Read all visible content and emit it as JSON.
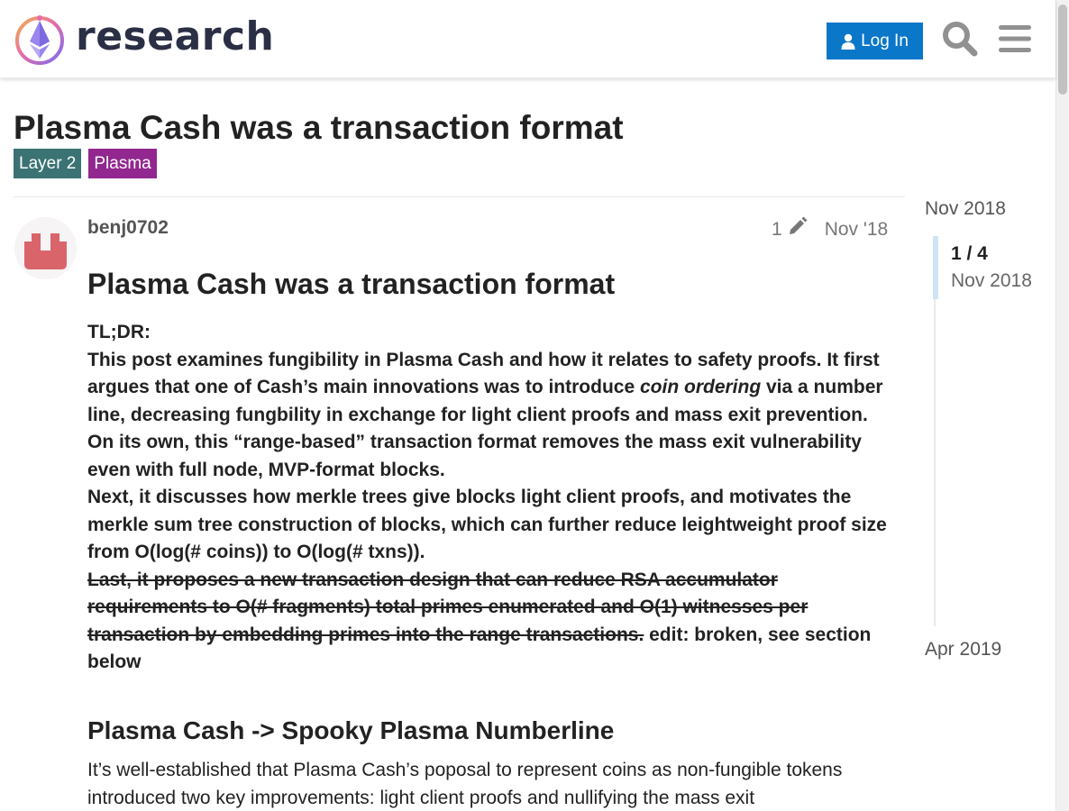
{
  "header": {
    "logo_text": "research",
    "login_label": "Log In",
    "icons": [
      "user-icon",
      "search-icon",
      "hamburger-menu-icon"
    ]
  },
  "topic": {
    "title": "Plasma Cash was a transaction format",
    "tags": [
      "Layer 2",
      "Plasma"
    ],
    "tag_colors": [
      "#3b7273",
      "#92278f"
    ]
  },
  "post": {
    "username": "benj0702",
    "edit_count": "1",
    "date": "Nov '18",
    "heading": "Plasma Cash was a transaction format",
    "tldr_label": "TL;DR:",
    "tldr_p1_a": "This post examines fungibility in Plasma Cash and how it relates to safety proofs. It first argues that one of Cash’s main innovations was to introduce ",
    "tldr_p1_em": "coin ordering",
    "tldr_p1_b": " via a number line, decreasing fungbility in exchange for light client proofs and mass exit prevention. On its own, this “range-based” transaction format removes the mass exit vulnerability even with full node, MVP-format blocks.",
    "tldr_p2": "Next, it discusses how merkle trees give blocks light client proofs, and motivates the merkle sum tree construction of blocks, which can further reduce leightweight proof size from O(log(# coins)) to O(log(# txns)).",
    "tldr_p3_struck": "Last, it proposes a new transaction design that can reduce RSA accumulator requirements to O(# fragments) total primes enumerated and O(1) witnesses per transaction by embedding primes into the range transactions.",
    "tldr_p3_after": " edit: broken, see section below",
    "section_heading": "Plasma Cash -> Spooky Plasma Numberline",
    "section_para": "It’s well-established that Plasma Cash’s poposal to represent coins as non-fungible tokens introduced two key improvements: light client proofs and nullifying the mass exit"
  },
  "timeline": {
    "start_date": "Nov 2018",
    "position": "1 / 4",
    "position_date": "Nov 2018",
    "end_date": "Apr 2019",
    "progress_fraction": 0.25
  },
  "colors": {
    "accent": "#0a77c9",
    "avatar": "#d9656b"
  }
}
